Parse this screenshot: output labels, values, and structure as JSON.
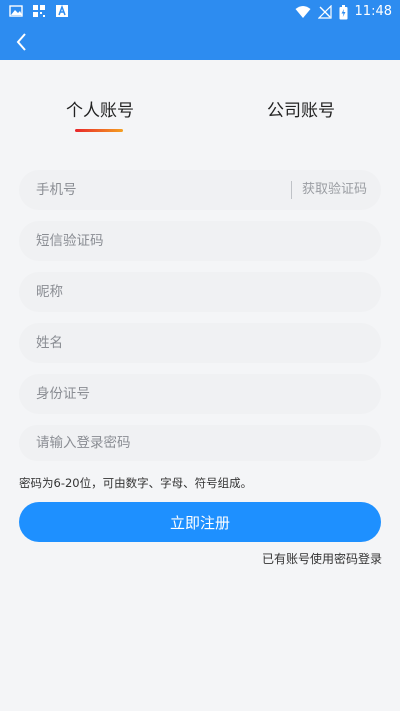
{
  "status_bar": {
    "time": "11:48",
    "icons": [
      "image-icon",
      "qr-icon",
      "text-a-icon",
      "wifi-icon",
      "no-signal-icon",
      "battery-icon"
    ]
  },
  "nav": {
    "back_icon": "chevron-left-icon"
  },
  "tabs": [
    {
      "label": "个人账号",
      "active": true
    },
    {
      "label": "公司账号",
      "active": false
    }
  ],
  "form": {
    "phone_placeholder": "手机号",
    "get_code_label": "获取验证码",
    "sms_code_placeholder": "短信验证码",
    "nickname_placeholder": "昵称",
    "name_placeholder": "姓名",
    "id_number_placeholder": "身份证号",
    "password_placeholder": "请输入登录密码",
    "password_hint": "密码为6-20位，可由数字、字母、符号组成。",
    "submit_label": "立即注册",
    "login_link_label": "已有账号使用密码登录"
  },
  "colors": {
    "header": "#2d8cf0",
    "primary_button": "#1e90ff",
    "tab_underline_start": "#e8262b",
    "tab_underline_end": "#f4a021"
  }
}
